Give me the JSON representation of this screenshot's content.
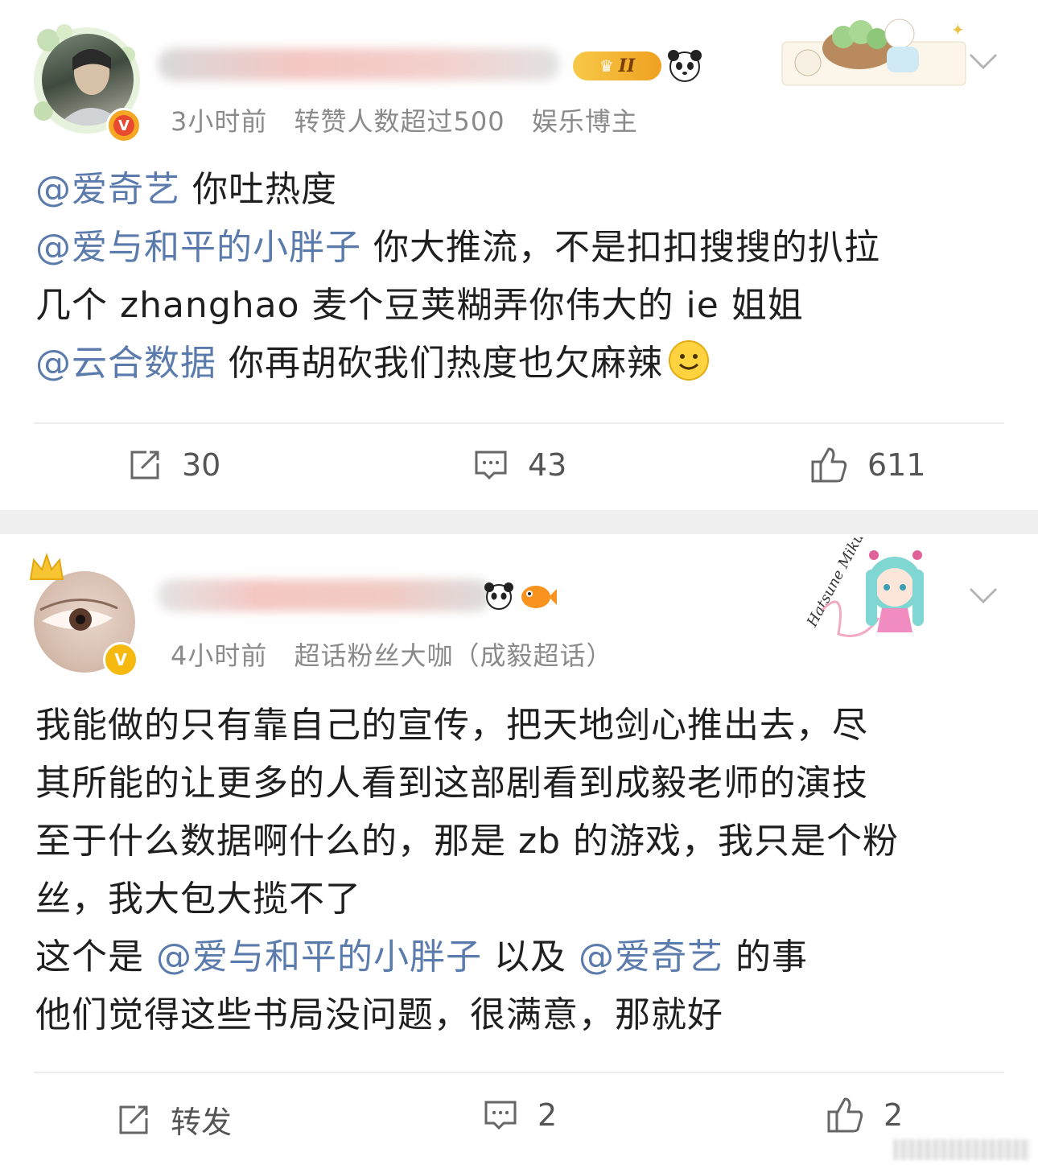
{
  "posts": [
    {
      "meta": {
        "time": "3小时前",
        "info": "转赞人数超过500",
        "tag": "娱乐博主"
      },
      "badge_level": "II",
      "content": {
        "line1": {
          "mention": "@爱奇艺",
          "text": " 你吐热度"
        },
        "line2": {
          "mention": "@爱与和平的小胖子",
          "text": " 你大推流，不是扣扣搜搜的扒拉"
        },
        "line3": {
          "text": "几个 zhanghao 麦个豆荚糊弄你伟大的 ie 姐姐"
        },
        "line4": {
          "mention": "@云合数据",
          "text": " 你再胡砍我们热度也欠麻辣"
        }
      },
      "actions": {
        "repost": "30",
        "comment": "43",
        "like": "611"
      }
    },
    {
      "meta": {
        "time": "4小时前",
        "info": "超话粉丝大咖（成毅超话）"
      },
      "deco_text": "Hatsune Miku",
      "content": {
        "line1": "我能做的只有靠自己的宣传，把天地剑心推出去，尽",
        "line2": "其所能的让更多的人看到这部剧看到成毅老师的演技",
        "line3": "至于什么数据啊什么的，那是 zb 的游戏，我只是个粉",
        "line4": "丝，我大包大揽不了",
        "line5": {
          "prefix": "这个是 ",
          "mention1": "@爱与和平的小胖子",
          "middle": " 以及 ",
          "mention2": "@爱奇艺",
          "suffix": " 的事"
        },
        "line6": "他们觉得这些书局没问题，很满意，那就好"
      },
      "actions": {
        "repost": "转发",
        "comment": "2",
        "like": "2"
      }
    }
  ],
  "colors": {
    "mention": "#5b7bac",
    "meta": "#8a8a8a",
    "divider": "#ededed",
    "verified_gold": "#f5a623",
    "verified_red": "#e8492f"
  },
  "icons": [
    "repost-icon",
    "comment-icon",
    "like-icon",
    "chevron-down-icon",
    "verified-badge-icon",
    "panda-icon",
    "crown-icon",
    "smile-emoji-icon"
  ]
}
